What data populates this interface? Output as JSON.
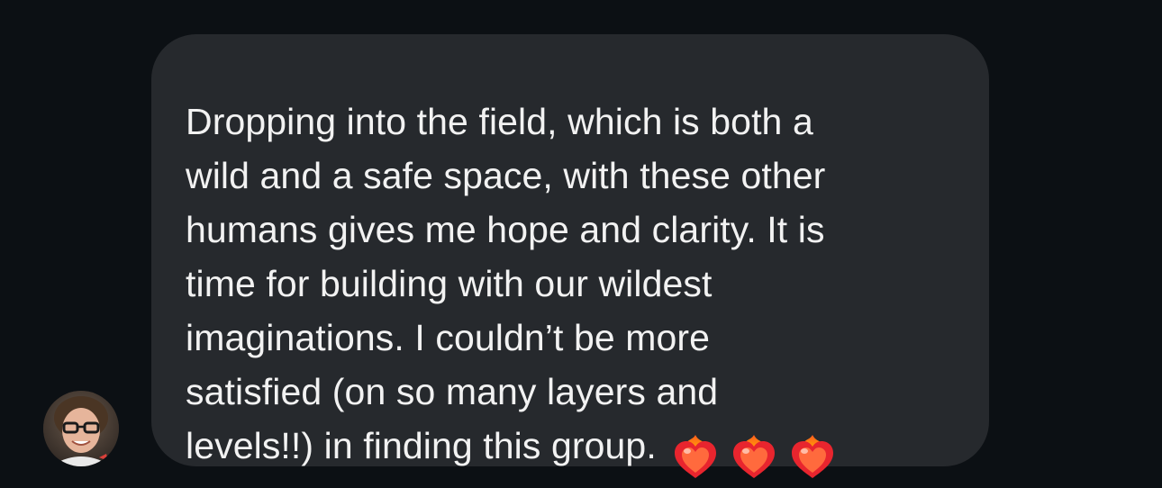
{
  "message": {
    "lines": [
      "Dropping into the field, which is both a",
      "wild and a safe space, with these other",
      "humans gives me hope and clarity. It is",
      "time for building with our wildest",
      "imaginations. I couldn’t be more",
      "satisfied (on so many layers and",
      "levels!!) in finding this group."
    ],
    "emoji": [
      "heart-on-fire",
      "heart-on-fire",
      "heart-on-fire"
    ]
  },
  "colors": {
    "background": "#0c1014",
    "bubble": "#26292d",
    "text": "#f2f2f2"
  },
  "avatar": {
    "icon": "user-avatar-photo"
  }
}
